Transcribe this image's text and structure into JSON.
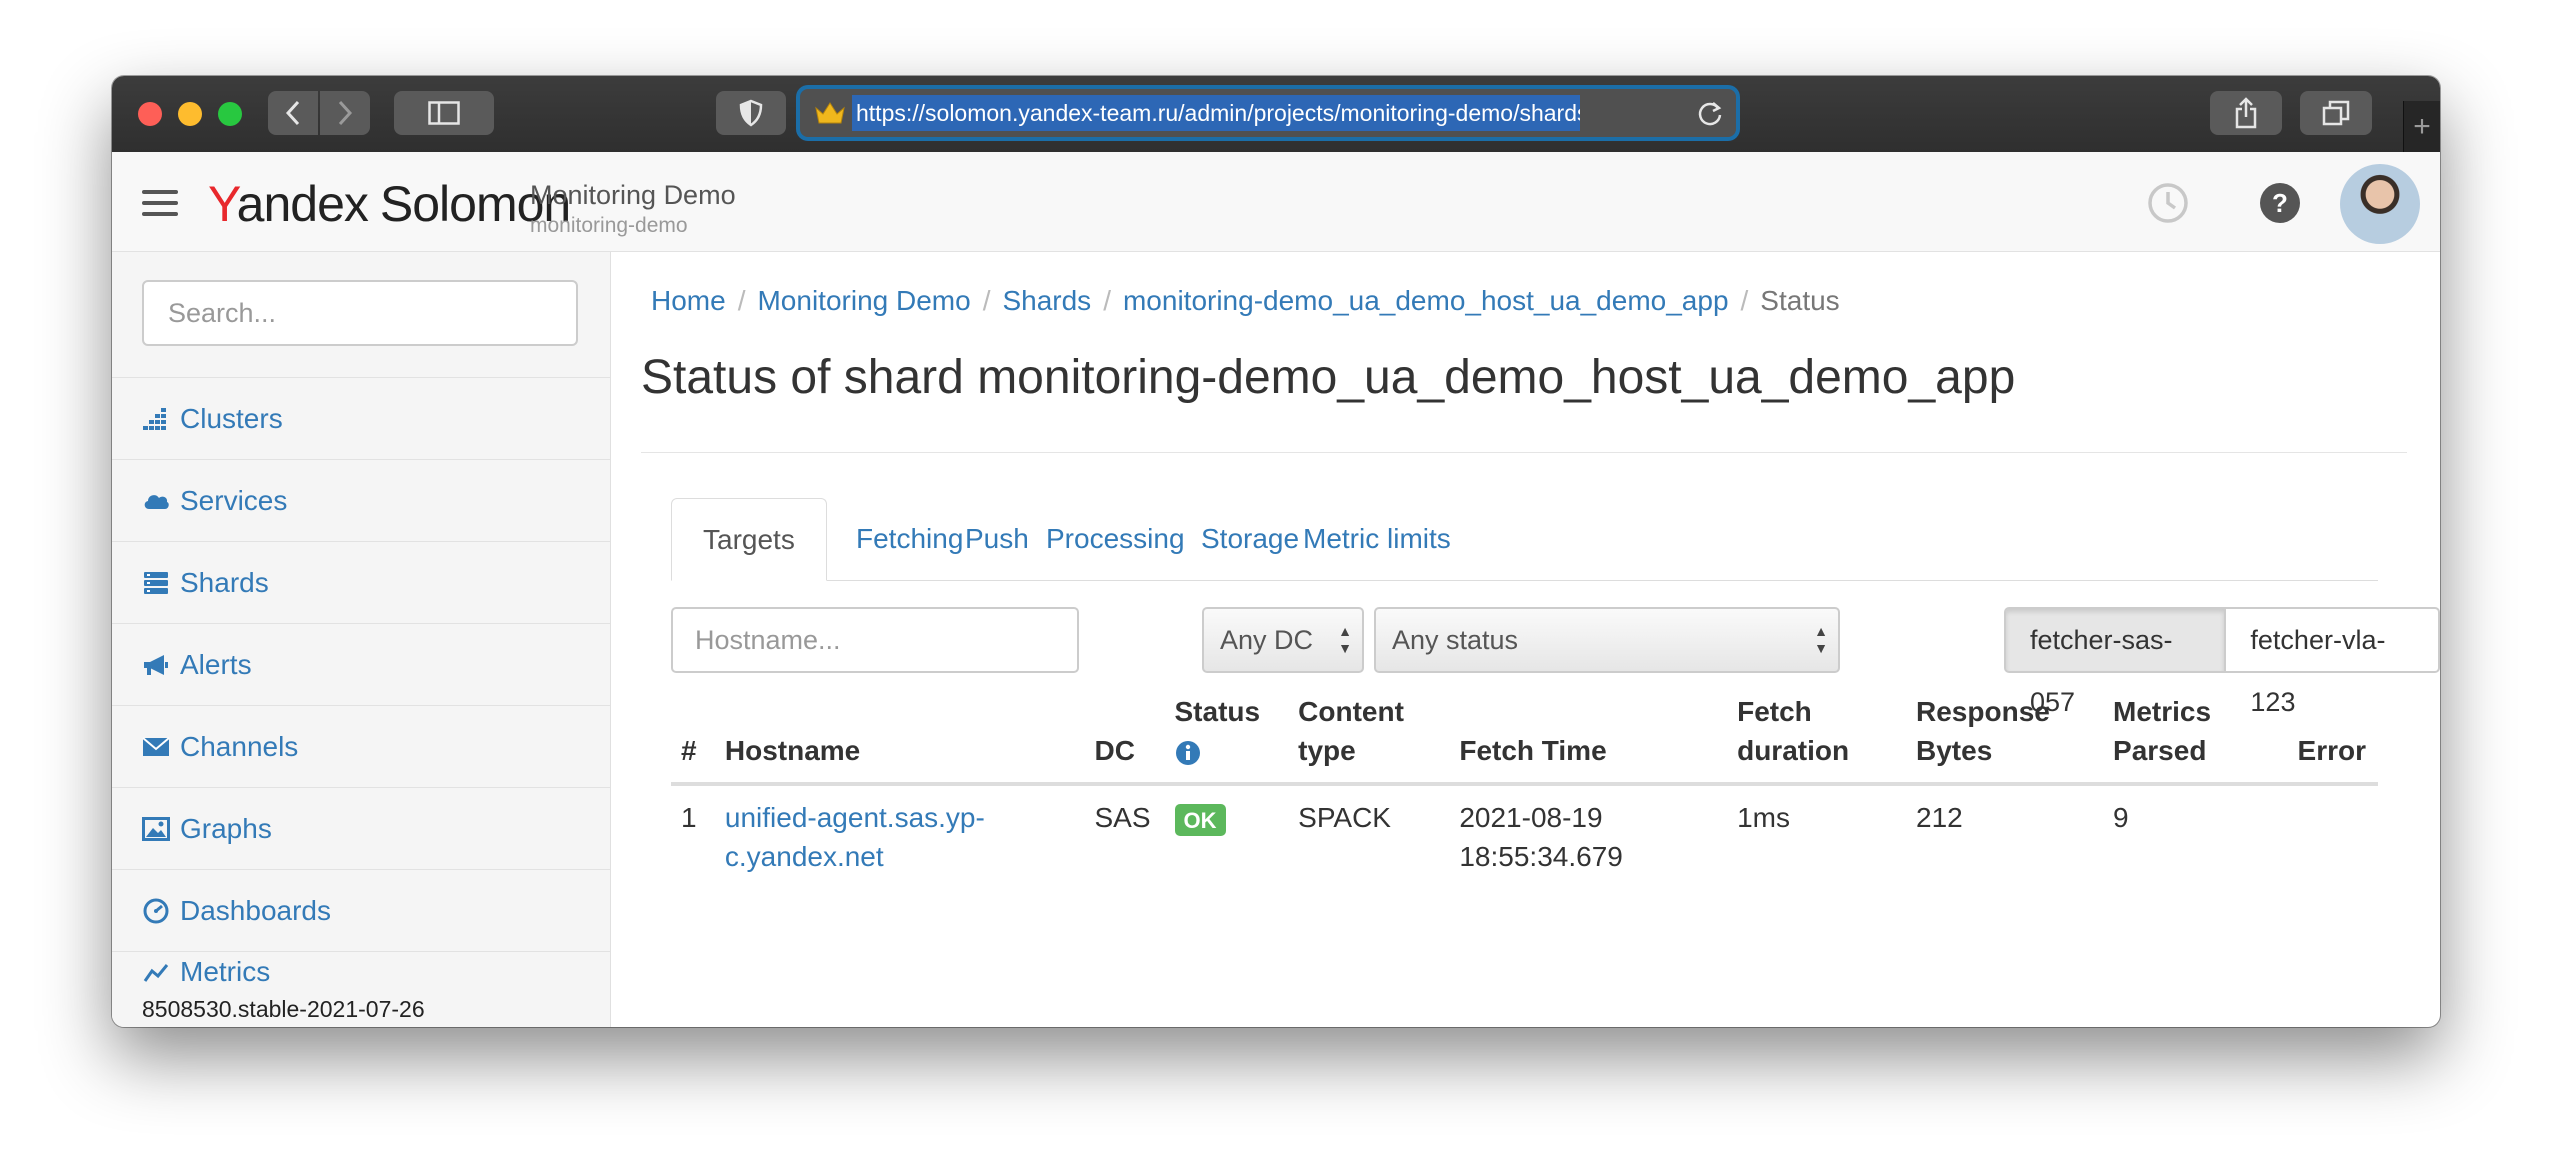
{
  "browser": {
    "url": "https://solomon.yandex-team.ru/admin/projects/monitoring-demo/shards/monitoring-demo_ua_demo_host_ua_demo_app/status"
  },
  "header": {
    "logo_y": "Y",
    "logo_rest": "andex",
    "logo_product": "Solomon",
    "project_title": "Monitoring Demo",
    "project_id": "monitoring-demo"
  },
  "sidebar": {
    "search_placeholder": "Search...",
    "items": [
      {
        "label": "Clusters",
        "icon": "clusters-icon"
      },
      {
        "label": "Services",
        "icon": "cloud-icon"
      },
      {
        "label": "Shards",
        "icon": "shards-icon"
      },
      {
        "label": "Alerts",
        "icon": "bullhorn-icon"
      },
      {
        "label": "Channels",
        "icon": "envelope-icon"
      },
      {
        "label": "Graphs",
        "icon": "picture-icon"
      },
      {
        "label": "Dashboards",
        "icon": "dashboard-icon"
      },
      {
        "label": "Metrics",
        "icon": "metrics-icon"
      }
    ],
    "version": "8508530.stable-2021-07-26"
  },
  "breadcrumb": {
    "home": "Home",
    "project": "Monitoring Demo",
    "shards": "Shards",
    "shard": "monitoring-demo_ua_demo_host_ua_demo_app",
    "current": "Status"
  },
  "page_title": "Status of shard monitoring-demo_ua_demo_host_ua_demo_app",
  "tabs": [
    "Targets",
    "Fetching",
    "Push",
    "Processing",
    "Storage",
    "Metric limits"
  ],
  "filters": {
    "hostname_placeholder": "Hostname...",
    "dc_selected": "Any DC",
    "status_selected": "Any status",
    "fetchers": [
      "fetcher-sas-057",
      "fetcher-vla-123"
    ]
  },
  "table": {
    "headers": {
      "num": "#",
      "hostname": "Hostname",
      "dc": "DC",
      "status": "Status",
      "content_type_1": "Content",
      "content_type_2": "type",
      "fetch_time": "Fetch Time",
      "fetch_duration_1": "Fetch",
      "fetch_duration_2": "duration",
      "response_bytes_1": "Response",
      "response_bytes_2": "Bytes",
      "metrics_parsed_1": "Metrics",
      "metrics_parsed_2": "Parsed",
      "error": "Error"
    },
    "rows": [
      {
        "num": "1",
        "hostname_1": "unified-agent.sas.yp-",
        "hostname_2": "c.yandex.net",
        "dc": "SAS",
        "status": "OK",
        "content_type": "SPACK",
        "fetch_date": "2021-08-19",
        "fetch_time": "18:55:34.679",
        "fetch_duration": "1ms",
        "response_bytes": "212",
        "metrics_parsed": "9",
        "error": ""
      }
    ]
  }
}
